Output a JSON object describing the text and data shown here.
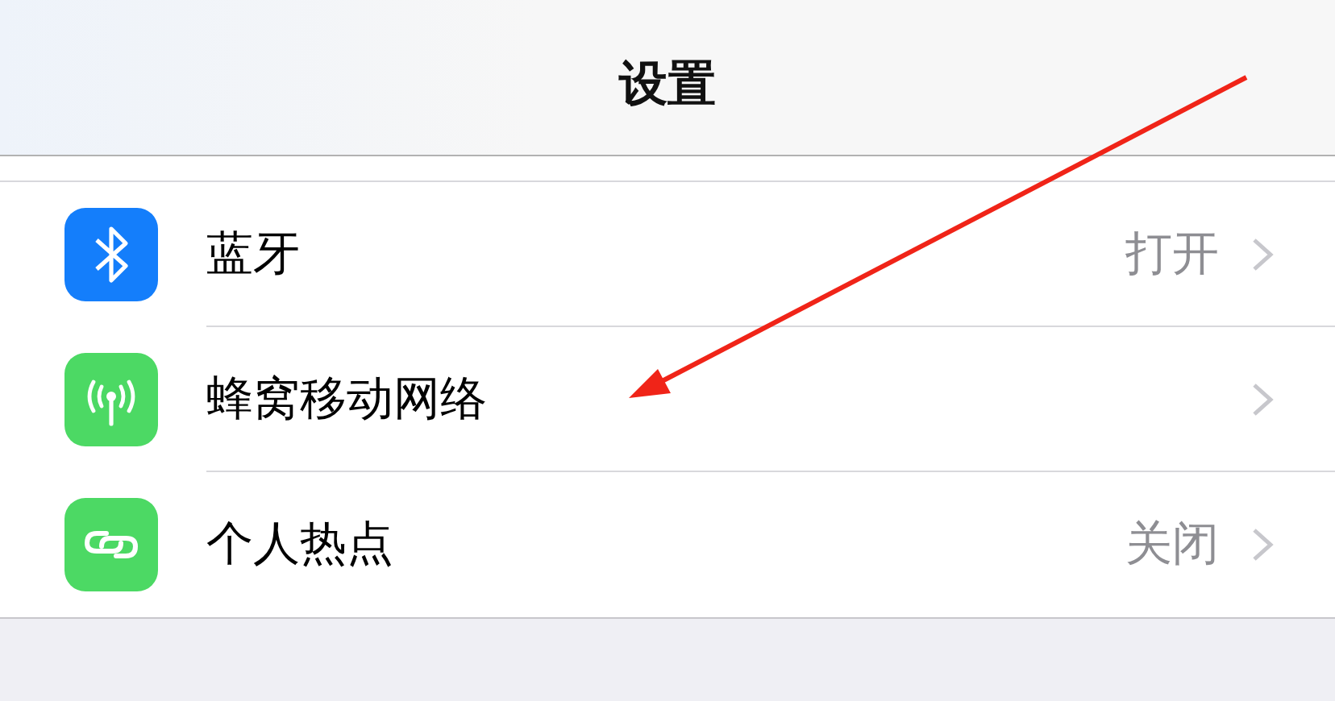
{
  "nav_bar": {
    "title": "设置"
  },
  "rows": [
    {
      "kind": "bluetooth",
      "color": "#147efb",
      "label": "蓝牙",
      "value": "打开"
    },
    {
      "kind": "cellular",
      "color": "#4cd964",
      "label": "蜂窝移动网络"
    },
    {
      "kind": "hotspot",
      "color": "#4cd964",
      "label": "个人热点",
      "value": "关闭"
    }
  ]
}
